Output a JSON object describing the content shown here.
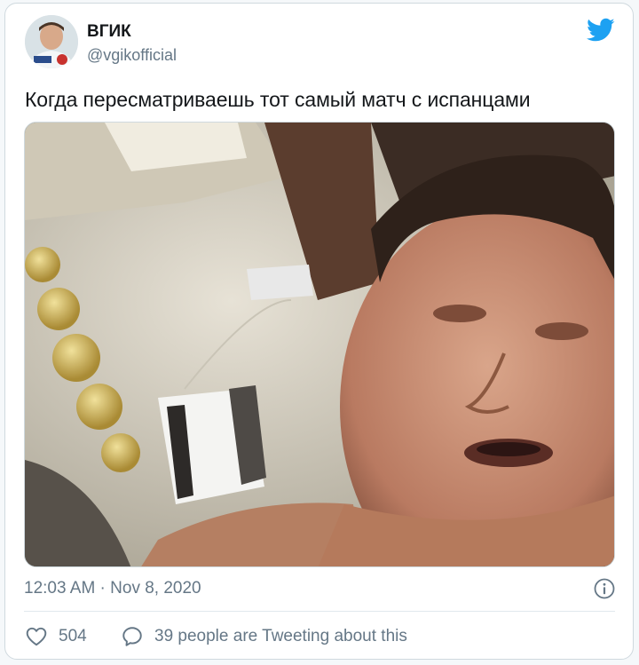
{
  "tweet": {
    "author_name": "ВГИК",
    "author_handle": "@vgikofficial",
    "text": "Когда пересматриваешь тот самый матч с испанцами",
    "timestamp": "12:03 AM · Nov 8, 2020",
    "likes_count": "504",
    "tweeting_text": "39 people are Tweeting about this"
  },
  "icons": {
    "brand": "twitter-bird-icon",
    "info": "info-icon",
    "like": "heart-icon",
    "reply": "speech-bubble-icon"
  },
  "colors": {
    "brand": "#1da1f2",
    "secondary_text": "#657786",
    "border": "#cfd9de"
  }
}
